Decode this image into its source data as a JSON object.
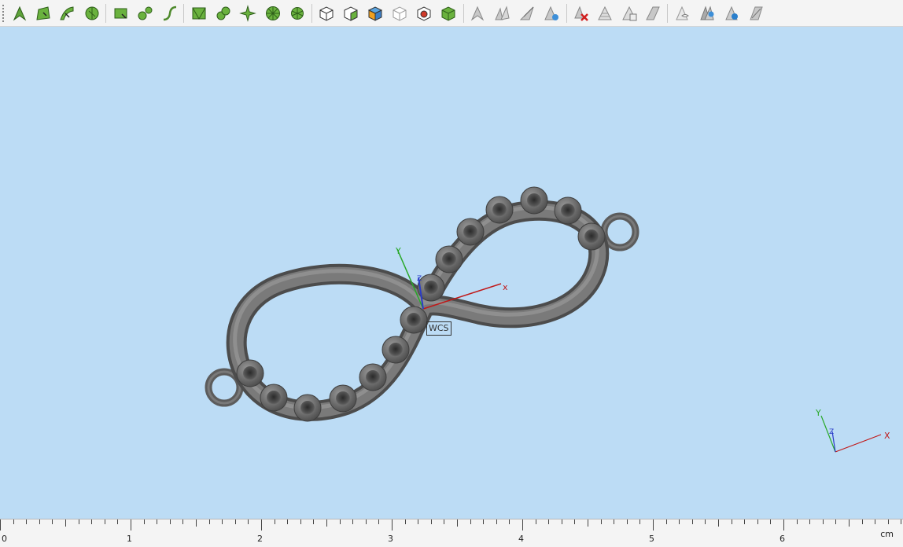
{
  "toolbar": {
    "groups": [
      {
        "name": "curve-tools",
        "buttons": [
          "select-arrow-icon",
          "surface-patch-icon",
          "sweep-icon",
          "revolve-icon"
        ]
      },
      {
        "name": "shape-tools",
        "buttons": [
          "rectangle-icon",
          "blob-icon",
          "spline-icon"
        ]
      },
      {
        "name": "pattern-tools",
        "buttons": [
          "mesh-icon",
          "gem-cluster-icon",
          "flower-icon",
          "round-pattern-icon",
          "radial-icon"
        ]
      },
      {
        "name": "solid-tools",
        "buttons": [
          "box-icon",
          "box-face-icon",
          "box-colored-icon",
          "box-outline-icon",
          "box-sphere-icon",
          "box-dots-icon"
        ]
      },
      {
        "name": "edit-tools",
        "buttons": [
          "arrow-gray-icon",
          "arrow-double-icon",
          "arrow-split-icon",
          "arrow-cycle-icon"
        ]
      },
      {
        "name": "mesh-tools",
        "buttons": [
          "delete-x-icon",
          "triangle-mesh-icon",
          "triangle-copy-icon",
          "triangle-cut-icon"
        ]
      },
      {
        "name": "view-tools",
        "buttons": [
          "visibility-icon",
          "layers-visibility-icon",
          "eye-icon",
          "hide-icon"
        ]
      }
    ]
  },
  "viewport": {
    "wcs_label": "WCS",
    "axis_x": "x",
    "axis_y": "Y",
    "axis_z": "Z",
    "corner_x": "X",
    "corner_y": "Y",
    "corner_z": "Z",
    "background_color": "#bcdcf5",
    "model": "infinity-pendant"
  },
  "ruler": {
    "labels": [
      "0",
      "1",
      "2",
      "3",
      "4",
      "5",
      "6"
    ],
    "unit": "cm"
  }
}
